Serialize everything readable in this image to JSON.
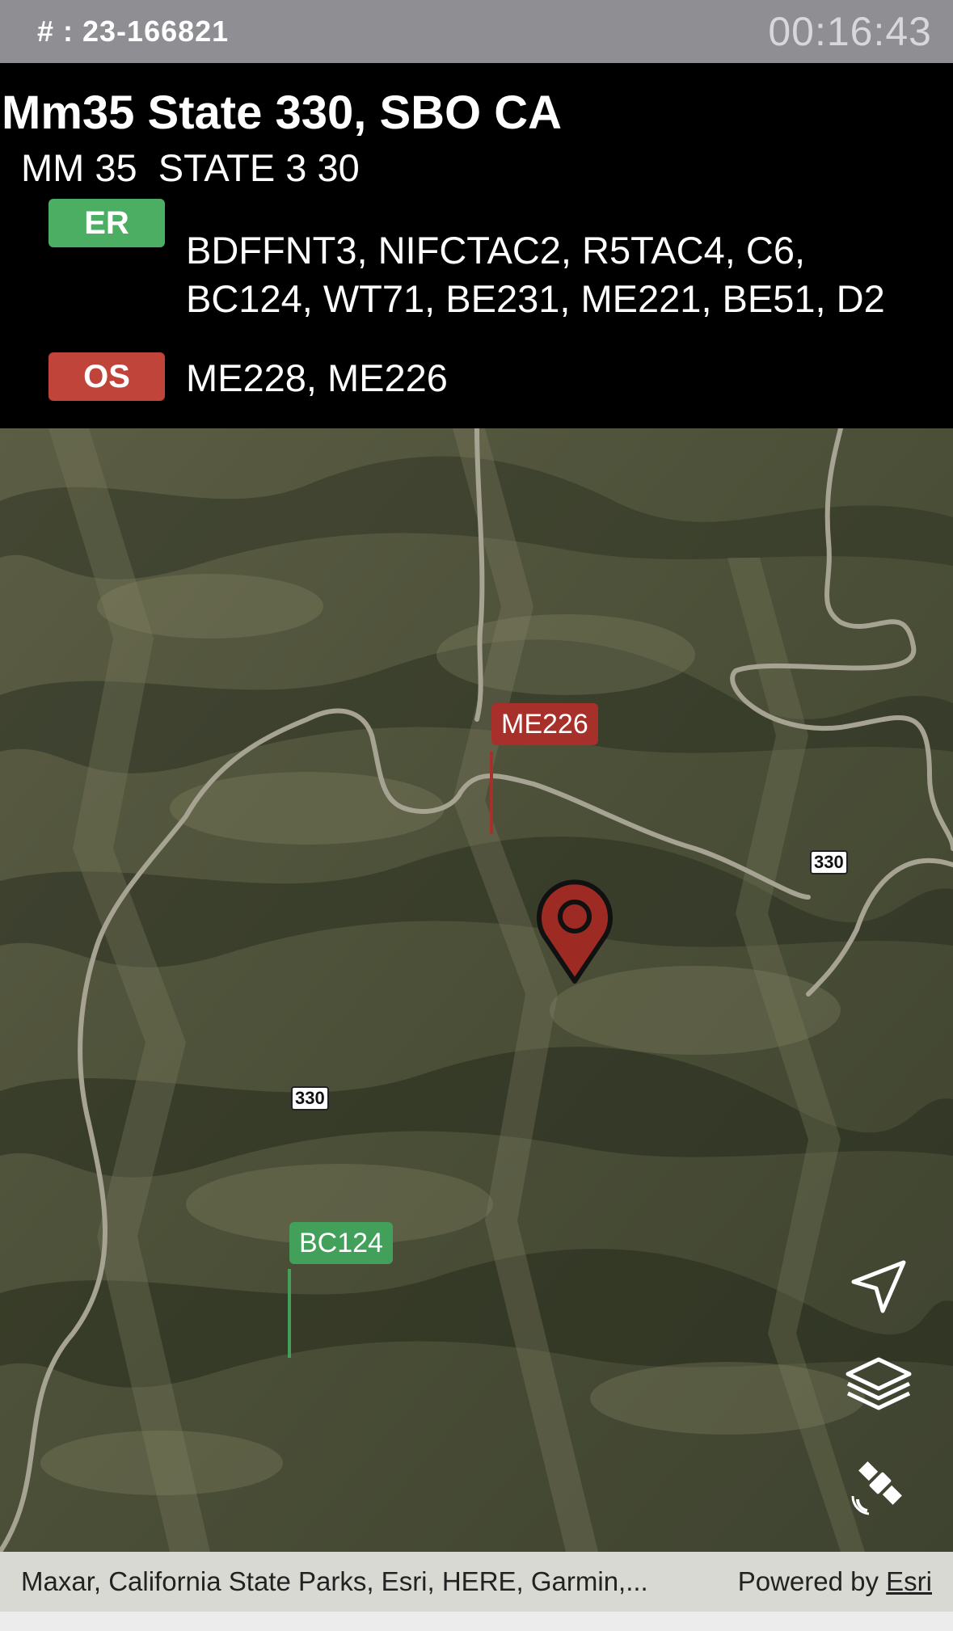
{
  "status_bar": {
    "incident_number": "# : 23-166821",
    "elapsed_time": "00:16:43"
  },
  "header": {
    "location_title": "Mm35 State 330, SBO CA",
    "location_subtitle": "MM 35  STATE 3 30",
    "en_route": {
      "badge": "ER",
      "badge_color": "#4cae62",
      "units": "BDFFNT3, NIFCTAC2, R5TAC4, C6, BC124, WT71, BE231, ME221, BE51, D2"
    },
    "on_scene": {
      "badge": "OS",
      "badge_color": "#c0443a",
      "units": "ME228, ME226"
    }
  },
  "map": {
    "highway_shields": [
      "330",
      "330"
    ],
    "unit_flags": [
      {
        "label": "ME226",
        "color": "#a8302a"
      },
      {
        "label": "BC124",
        "color": "#42a05a"
      }
    ],
    "incident_pin_icon": "map-pin-icon",
    "controls": [
      {
        "name": "locate",
        "icon": "location-arrow-icon"
      },
      {
        "name": "layers",
        "icon": "layers-icon"
      },
      {
        "name": "basemap",
        "icon": "satellite-icon"
      }
    ]
  },
  "attribution": {
    "text": "Maxar, California State Parks, Esri, HERE, Garmin,...",
    "powered_prefix": "Powered by ",
    "powered_link": "Esri"
  }
}
